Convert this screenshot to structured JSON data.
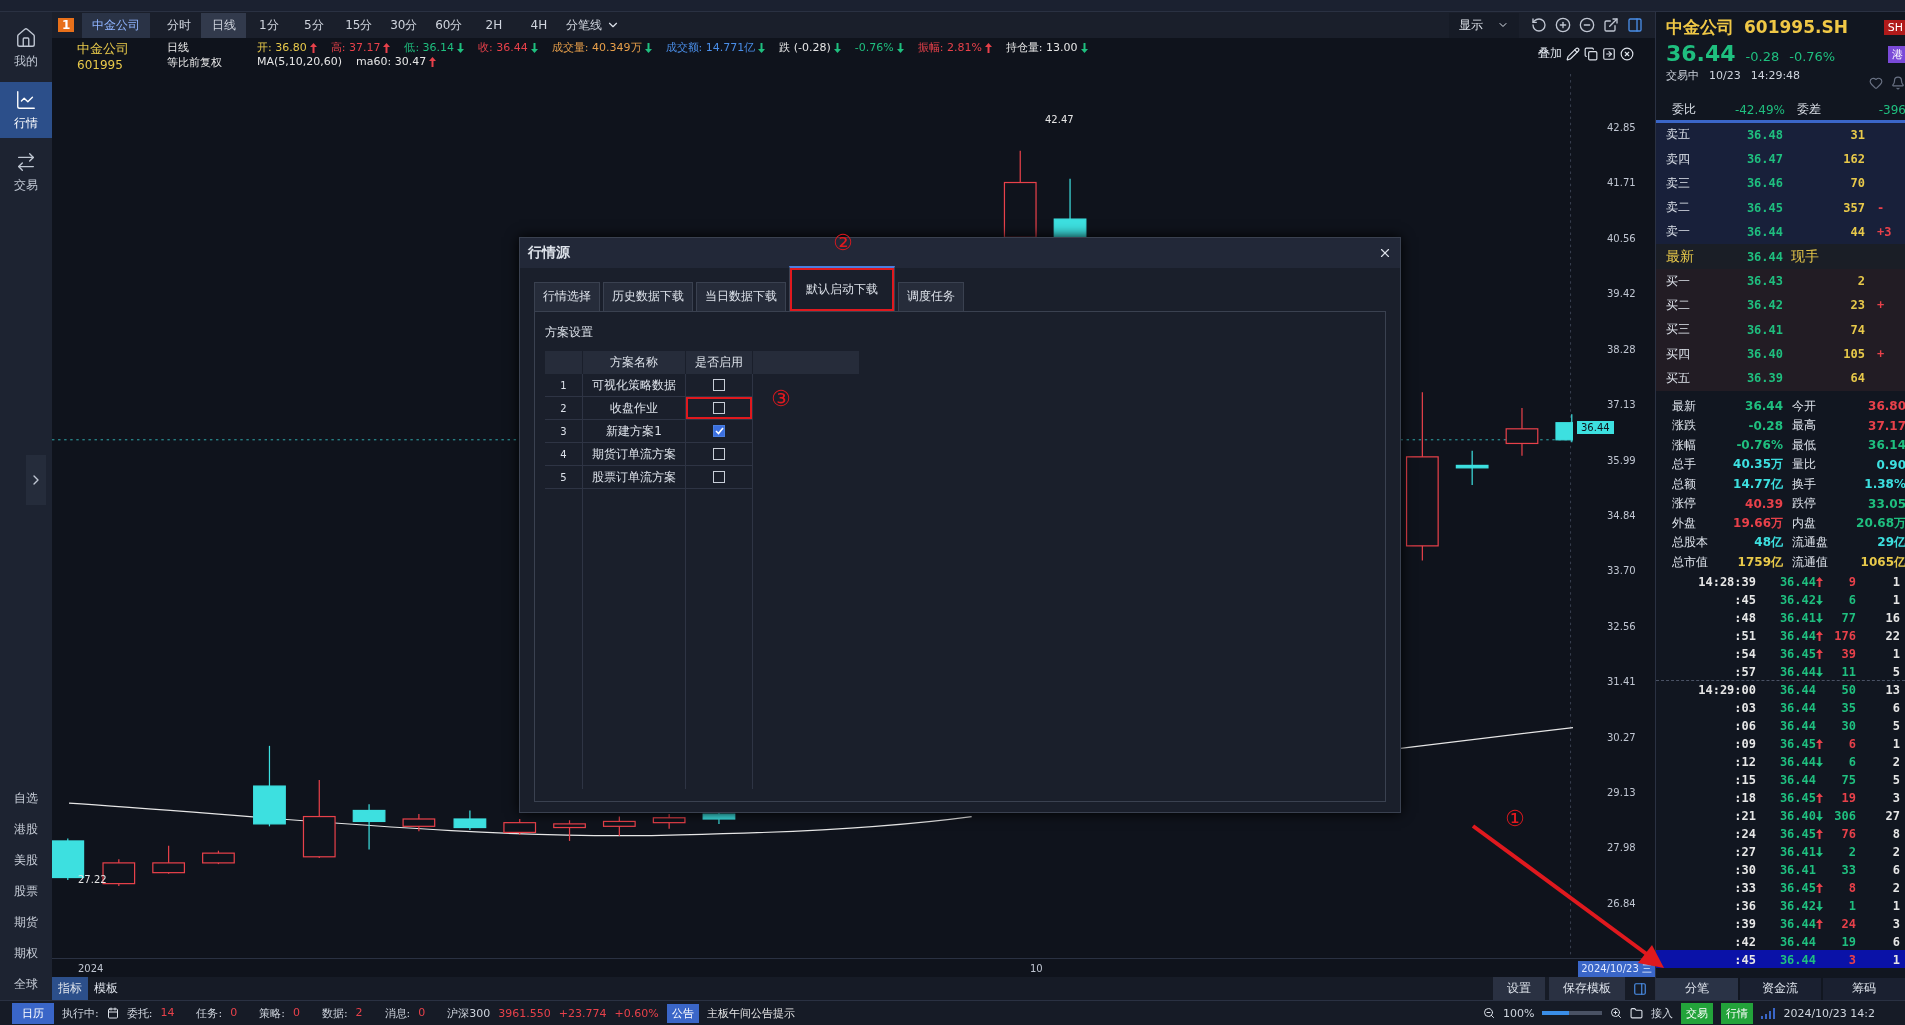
{
  "sidebar": {
    "nav": [
      {
        "label": "我的",
        "kind": "home",
        "selected": false
      },
      {
        "label": "行情",
        "kind": "chart",
        "selected": true
      },
      {
        "label": "交易",
        "kind": "trade",
        "selected": false
      }
    ],
    "markets": [
      "自选",
      "港股",
      "美股",
      "股票",
      "期货",
      "期权",
      "全球"
    ]
  },
  "toolbar": {
    "badge": "1",
    "stock_tab": "中金公司",
    "periods": [
      {
        "label": "分时",
        "selected": false
      },
      {
        "label": "日线",
        "selected": true
      },
      {
        "label": "1分",
        "selected": false
      },
      {
        "label": "5分",
        "selected": false
      },
      {
        "label": "15分",
        "selected": false
      },
      {
        "label": "30分",
        "selected": false
      },
      {
        "label": "60分",
        "selected": false
      },
      {
        "label": "2H",
        "selected": false
      },
      {
        "label": "4H",
        "selected": false
      },
      {
        "label": "分笔线",
        "selected": false
      }
    ],
    "display": "显示"
  },
  "info": {
    "name": "中金公司",
    "code": "601995",
    "period": "日线",
    "adjust": "等比前复权",
    "ma": "MA(5,10,20,60)",
    "ma60": {
      "label": "ma60:",
      "value": "30.47",
      "kind": "up"
    },
    "fields": [
      {
        "label": "开:",
        "value": "36.80",
        "kind": "up",
        "color": "#e8c94a"
      },
      {
        "label": "高:",
        "value": "37.17",
        "kind": "up",
        "color": "#e8414a"
      },
      {
        "label": "低:",
        "value": "36.14",
        "kind": "down",
        "color": "#1fbf7f"
      },
      {
        "label": "收:",
        "value": "36.44",
        "kind": "down",
        "color": "#e8414a"
      },
      {
        "label": "成交量:",
        "value": "40.349万",
        "kind": "down",
        "color": "#e8a04a"
      },
      {
        "label": "成交额:",
        "value": "14.771亿",
        "kind": "down",
        "color": "#4a8ee8"
      },
      {
        "label": "跌",
        "value": "(-0.28)",
        "kind": "down",
        "color": "#e6e6e6"
      },
      {
        "value": "-0.76%",
        "kind": "down",
        "color": "#1fbf7f"
      },
      {
        "label": "振幅:",
        "value": "2.81%",
        "kind": "up",
        "color": "#e8414a"
      },
      {
        "label": "持仓量:",
        "value": "13.00",
        "kind": "down",
        "color": "#e6e6e6"
      }
    ]
  },
  "chart": {
    "overlay_label": "叠加",
    "price_axis": [
      "42.85",
      "41.71",
      "40.56",
      "39.42",
      "38.28",
      "37.13",
      "35.99",
      "34.84",
      "33.70",
      "32.56",
      "31.41",
      "30.27",
      "29.13",
      "27.98",
      "26.84"
    ],
    "high_label": "42.47",
    "low_label": "27.22",
    "last_price": "36.44",
    "x_labels": [
      "2024",
      "10"
    ],
    "date_tag": "2024/10/23 三"
  },
  "bottom_tabs": [
    {
      "label": "指标",
      "selected": true
    },
    {
      "label": "模板",
      "selected": false
    }
  ],
  "bottom_buttons": [
    "设置",
    "保存模板"
  ],
  "dialog": {
    "title": "行情源",
    "tabs": [
      {
        "label": "行情选择",
        "selected": false,
        "highlighted": false
      },
      {
        "label": "历史数据下载",
        "selected": false,
        "highlighted": false
      },
      {
        "label": "当日数据下载",
        "selected": false,
        "highlighted": false
      },
      {
        "label": "默认启动下载",
        "selected": true,
        "highlighted": true
      },
      {
        "label": "调度任务",
        "selected": false,
        "highlighted": false
      }
    ],
    "section": "方案设置",
    "columns": [
      "方案名称",
      "是否启用"
    ],
    "rows": [
      {
        "index": "1",
        "name": "可视化策略数据",
        "enabled": false,
        "highlighted": false
      },
      {
        "index": "2",
        "name": "收盘作业",
        "enabled": false,
        "highlighted": true
      },
      {
        "index": "3",
        "name": "新建方案1",
        "enabled": true,
        "highlighted": false
      },
      {
        "index": "4",
        "name": "期货订单流方案",
        "enabled": false,
        "highlighted": false
      },
      {
        "index": "5",
        "name": "股票订单流方案",
        "enabled": false,
        "highlighted": false
      }
    ]
  },
  "annotations": [
    {
      "kind": "status",
      "label": "①"
    },
    {
      "kind": "tab",
      "label": "②"
    },
    {
      "kind": "checkbox",
      "label": "③"
    }
  ],
  "quote": {
    "name": "中金公司",
    "code": "601995.SH",
    "exchange_badge": "SH",
    "price": "36.44",
    "change": "-0.28",
    "change_pct": "-0.76%",
    "hk_badge": "港",
    "status": "交易中",
    "date": "10/23",
    "time": "14:29:48",
    "ratio_label": "委比",
    "ratio": "-42.49%",
    "diff_label": "委差",
    "diff": "-396",
    "asks": [
      {
        "label": "卖五",
        "price": "36.48",
        "volume": "31"
      },
      {
        "label": "卖四",
        "price": "36.47",
        "volume": "162"
      },
      {
        "label": "卖三",
        "price": "36.46",
        "volume": "70"
      },
      {
        "label": "卖二",
        "price": "36.45",
        "volume": "357",
        "change": "-"
      },
      {
        "label": "卖一",
        "price": "36.44",
        "volume": "44",
        "change": "+3"
      }
    ],
    "last": {
      "label": "最新",
      "price": "36.44",
      "note": "现手"
    },
    "bids": [
      {
        "label": "买一",
        "price": "36.43",
        "volume": "2"
      },
      {
        "label": "买二",
        "price": "36.42",
        "volume": "23",
        "change": "+"
      },
      {
        "label": "买三",
        "price": "36.41",
        "volume": "74"
      },
      {
        "label": "买四",
        "price": "36.40",
        "volume": "105",
        "change": "+"
      },
      {
        "label": "买五",
        "price": "36.39",
        "volume": "64"
      }
    ],
    "stats": [
      {
        "label": "最新",
        "value": "36.44",
        "color": "#1fbf7f"
      },
      {
        "label": "今开",
        "value": "36.80",
        "color": "#e8414a"
      },
      {
        "label": "涨跌",
        "value": "-0.28",
        "color": "#1fbf7f"
      },
      {
        "label": "最高",
        "value": "37.17",
        "color": "#e8414a"
      },
      {
        "label": "涨幅",
        "value": "-0.76%",
        "color": "#1fbf7f"
      },
      {
        "label": "最低",
        "value": "36.14",
        "color": "#1fbf7f"
      },
      {
        "label": "总手",
        "value": "40.35万",
        "color": "#3de0e0"
      },
      {
        "label": "量比",
        "value": "0.90",
        "color": "#3de0e0"
      },
      {
        "label": "总额",
        "value": "14.77亿",
        "color": "#3de0e0"
      },
      {
        "label": "换手",
        "value": "1.38%",
        "color": "#3de0e0"
      },
      {
        "label": "涨停",
        "value": "40.39",
        "color": "#e8414a"
      },
      {
        "label": "跌停",
        "value": "33.05",
        "color": "#1fbf7f"
      },
      {
        "label": "外盘",
        "value": "19.66万",
        "color": "#e8414a"
      },
      {
        "label": "内盘",
        "value": "20.68万",
        "color": "#1fbf7f"
      },
      {
        "label": "总股本",
        "value": "48亿",
        "color": "#3de0e0"
      },
      {
        "label": "流通盘",
        "value": "29亿",
        "color": "#3de0e0"
      },
      {
        "label": "总市值",
        "value": "1759亿",
        "color": "#e8c94a"
      },
      {
        "label": "流通值",
        "value": "1065亿",
        "color": "#e8c94a"
      }
    ],
    "ticks": [
      {
        "time": "14:28:39",
        "price": "36.44",
        "kind": "up",
        "volume": "9",
        "color": "#e8414a",
        "count": "1",
        "minute_start": false,
        "selected": false
      },
      {
        "time": ":45",
        "price": "36.42",
        "kind": "down",
        "volume": "6",
        "color": "#1fbf7f",
        "count": "1",
        "minute_start": false,
        "selected": false
      },
      {
        "time": ":48",
        "price": "36.41",
        "kind": "down",
        "volume": "77",
        "color": "#1fbf7f",
        "count": "16",
        "minute_start": false,
        "selected": false
      },
      {
        "time": ":51",
        "price": "36.44",
        "kind": "up",
        "volume": "176",
        "color": "#e8414a",
        "count": "22",
        "minute_start": false,
        "selected": false
      },
      {
        "time": ":54",
        "price": "36.45",
        "kind": "up",
        "volume": "39",
        "color": "#e8414a",
        "count": "1",
        "minute_start": false,
        "selected": false
      },
      {
        "time": ":57",
        "price": "36.44",
        "kind": "down",
        "volume": "11",
        "color": "#1fbf7f",
        "count": "5",
        "minute_start": false,
        "selected": false
      },
      {
        "time": "14:29:00",
        "price": "36.44",
        "kind": "none",
        "volume": "50",
        "color": "#1fbf7f",
        "count": "13",
        "minute_start": true,
        "selected": false
      },
      {
        "time": ":03",
        "price": "36.44",
        "kind": "none",
        "volume": "35",
        "color": "#1fbf7f",
        "count": "6",
        "minute_start": false,
        "selected": false
      },
      {
        "time": ":06",
        "price": "36.44",
        "kind": "none",
        "volume": "30",
        "color": "#1fbf7f",
        "count": "5",
        "minute_start": false,
        "selected": false
      },
      {
        "time": ":09",
        "price": "36.45",
        "kind": "up",
        "volume": "6",
        "color": "#e8414a",
        "count": "1",
        "minute_start": false,
        "selected": false
      },
      {
        "time": ":12",
        "price": "36.44",
        "kind": "down",
        "volume": "6",
        "color": "#1fbf7f",
        "count": "2",
        "minute_start": false,
        "selected": false
      },
      {
        "time": ":15",
        "price": "36.44",
        "kind": "none",
        "volume": "75",
        "color": "#1fbf7f",
        "count": "5",
        "minute_start": false,
        "selected": false
      },
      {
        "time": ":18",
        "price": "36.45",
        "kind": "up",
        "volume": "19",
        "color": "#e8414a",
        "count": "3",
        "minute_start": false,
        "selected": false
      },
      {
        "time": ":21",
        "price": "36.40",
        "kind": "down",
        "volume": "306",
        "color": "#1fbf7f",
        "count": "27",
        "minute_start": false,
        "selected": false
      },
      {
        "time": ":24",
        "price": "36.45",
        "kind": "up",
        "volume": "76",
        "color": "#e8414a",
        "count": "8",
        "minute_start": false,
        "selected": false
      },
      {
        "time": ":27",
        "price": "36.41",
        "kind": "down",
        "volume": "2",
        "color": "#1fbf7f",
        "count": "2",
        "minute_start": false,
        "selected": false
      },
      {
        "time": ":30",
        "price": "36.41",
        "kind": "none",
        "volume": "33",
        "color": "#1fbf7f",
        "count": "6",
        "minute_start": false,
        "selected": false
      },
      {
        "time": ":33",
        "price": "36.45",
        "kind": "up",
        "volume": "8",
        "color": "#e8414a",
        "count": "2",
        "minute_start": false,
        "selected": false
      },
      {
        "time": ":36",
        "price": "36.42",
        "kind": "down",
        "volume": "1",
        "color": "#1fbf7f",
        "count": "1",
        "minute_start": false,
        "selected": false
      },
      {
        "time": ":39",
        "price": "36.44",
        "kind": "up",
        "volume": "24",
        "color": "#e8414a",
        "count": "3",
        "minute_start": false,
        "selected": false
      },
      {
        "time": ":42",
        "price": "36.44",
        "kind": "none",
        "volume": "19",
        "color": "#1fbf7f",
        "count": "6",
        "minute_start": false,
        "selected": false
      },
      {
        "time": ":45",
        "price": "36.44",
        "kind": "none",
        "volume": "3",
        "color": "#e8414a",
        "count": "1",
        "minute_start": false,
        "selected": true
      }
    ],
    "tabs": [
      {
        "label": "分笔",
        "selected": true
      },
      {
        "label": "资金流",
        "selected": false
      },
      {
        "label": "筹码",
        "selected": false
      }
    ]
  },
  "status_bar": {
    "calendar": "日历",
    "running": "执行中:",
    "counters": [
      {
        "label": "委托:",
        "value": "14"
      },
      {
        "label": "任务:",
        "value": "0"
      },
      {
        "label": "策略:",
        "value": "0"
      },
      {
        "label": "数据:",
        "value": "2"
      },
      {
        "label": "消息:",
        "value": "0"
      }
    ],
    "index": {
      "name": "沪深300",
      "value": "3961.550",
      "change": "+23.774",
      "pct": "+0.60%"
    },
    "notice_badge": "公告",
    "notice": "主板午间公告提示",
    "zoom": {
      "label": "100%",
      "level": 0.45
    },
    "connect": "接入",
    "modes": [
      {
        "label": "交易",
        "on": true
      },
      {
        "label": "行情",
        "on": true
      }
    ],
    "datetime": "2024/10/23 14:2"
  }
}
